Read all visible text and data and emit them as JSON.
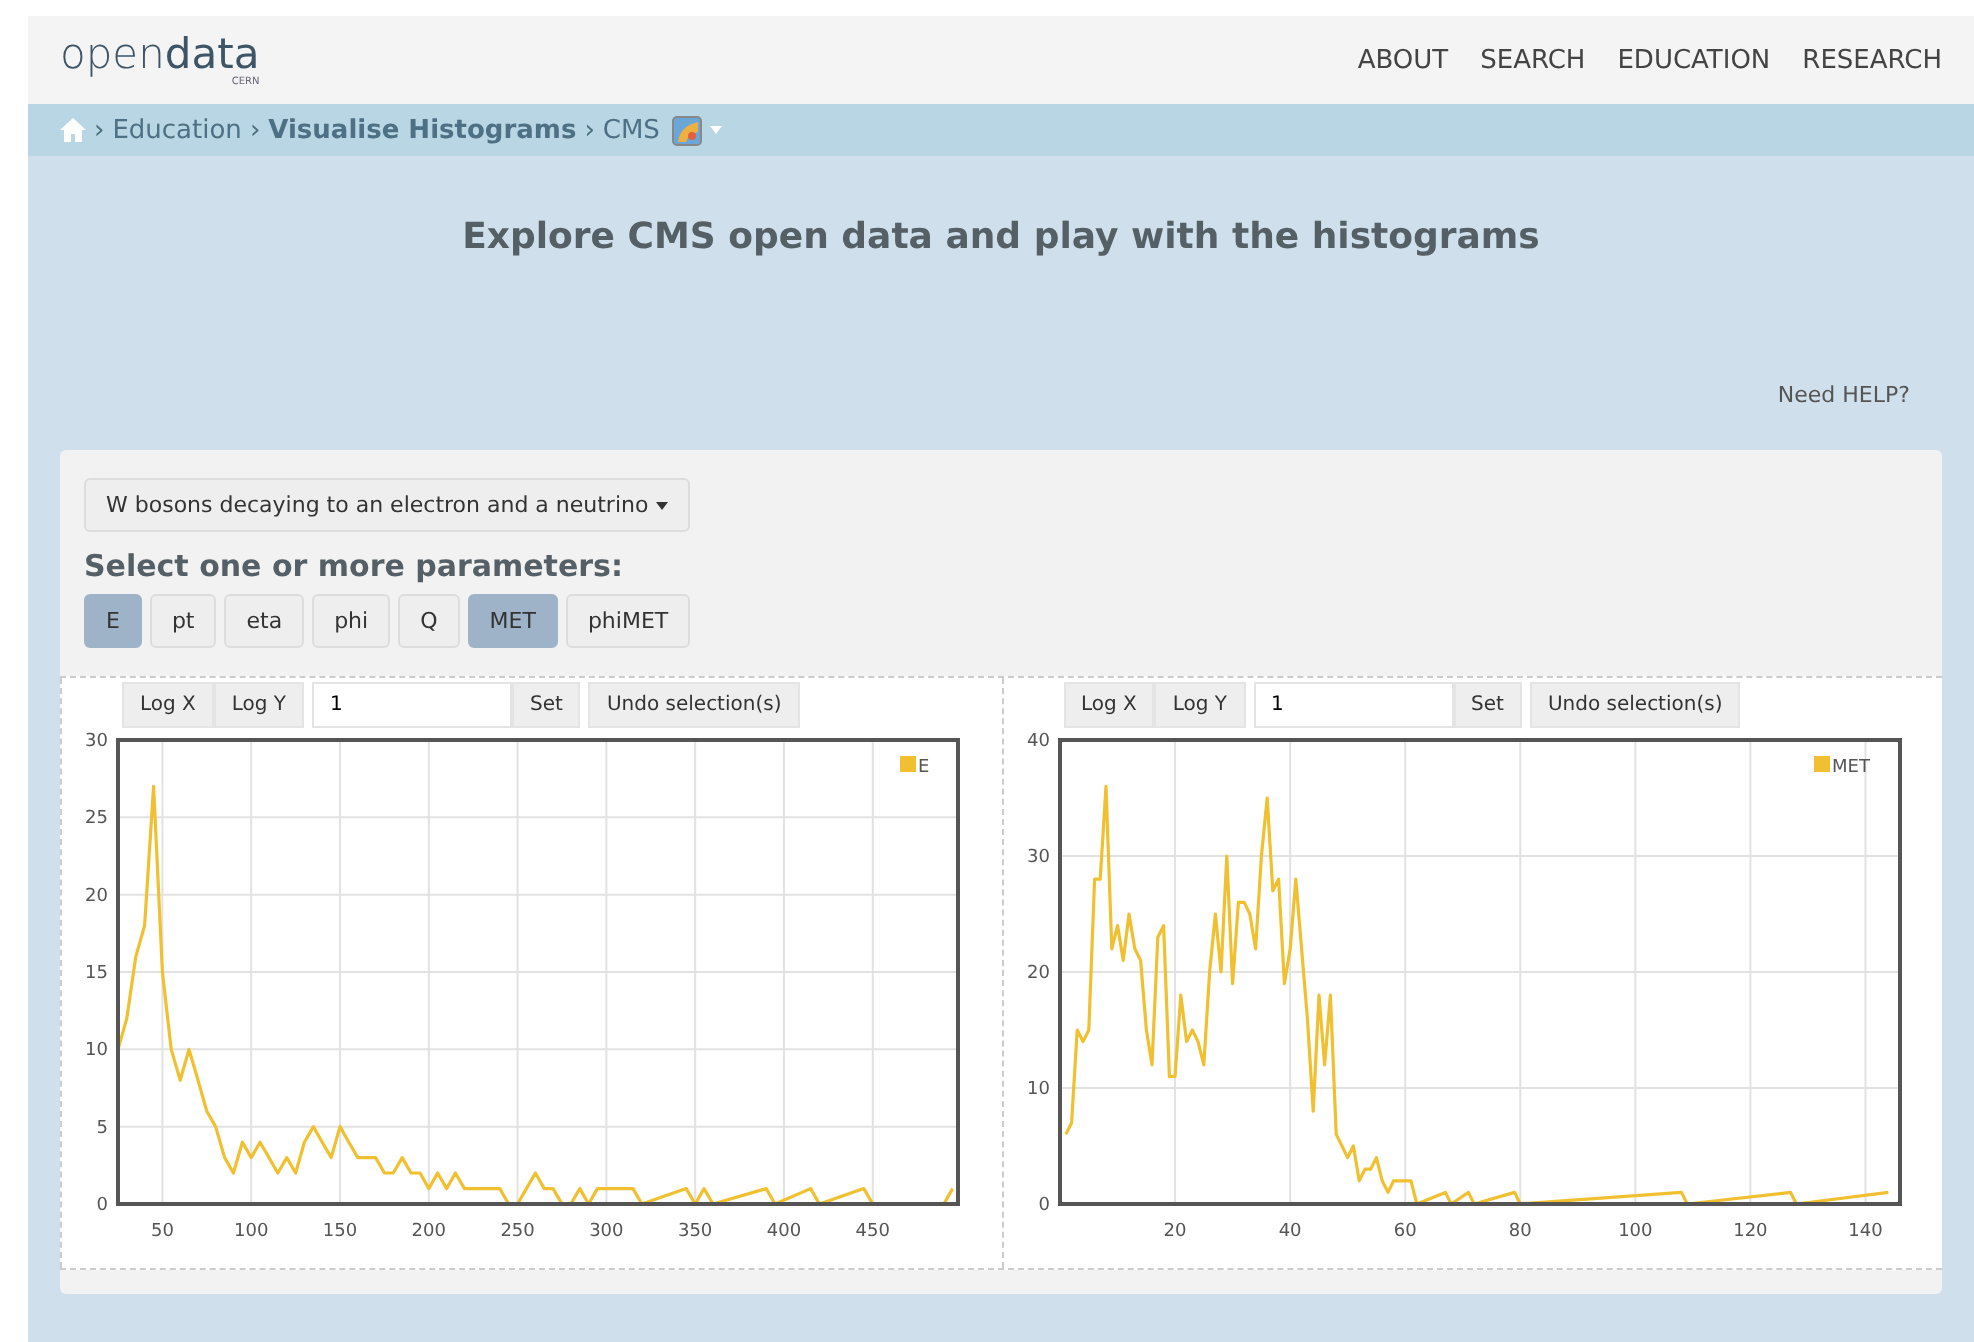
{
  "header": {
    "logo": "open**data**",
    "logo_sub": "CERN",
    "nav": [
      "ABOUT",
      "SEARCH",
      "EDUCATION",
      "RESEARCH"
    ]
  },
  "breadcrumb": {
    "separator": "›",
    "items": [
      {
        "label": "Education",
        "bold": false
      },
      {
        "label": "Visualise Histograms",
        "bold": true
      },
      {
        "label": "CMS",
        "bold": false
      }
    ]
  },
  "title": "Explore CMS open data and play with the histograms",
  "help_link": "Need HELP?",
  "dataset_dropdown": "W bosons decaying to an electron and a neutrino",
  "params_heading": "Select one or more parameters:",
  "params": [
    {
      "label": "E",
      "selected": true
    },
    {
      "label": "pt",
      "selected": false
    },
    {
      "label": "eta",
      "selected": false
    },
    {
      "label": "phi",
      "selected": false
    },
    {
      "label": "Q",
      "selected": false
    },
    {
      "label": "MET",
      "selected": true
    },
    {
      "label": "phiMET",
      "selected": false
    }
  ],
  "histograms": [
    {
      "toolbar": {
        "log_x": "Log X",
        "log_y": "Log Y",
        "bins_value": "1",
        "set": "Set",
        "undo": "Undo selection(s)"
      },
      "chart_data": {
        "type": "line",
        "grid": true,
        "xlim": [
          25,
          498
        ],
        "ylim": [
          0,
          30
        ],
        "xticks": [
          50,
          100,
          150,
          200,
          250,
          300,
          350,
          400,
          450
        ],
        "yticks": [
          0,
          5,
          10,
          15,
          20,
          25,
          30
        ],
        "x": [
          25,
          30,
          35,
          40,
          45,
          50,
          55,
          60,
          65,
          70,
          75,
          80,
          85,
          90,
          95,
          100,
          105,
          110,
          115,
          120,
          125,
          130,
          135,
          140,
          145,
          150,
          155,
          160,
          165,
          170,
          175,
          180,
          185,
          190,
          195,
          200,
          205,
          210,
          215,
          220,
          225,
          230,
          235,
          240,
          245,
          250,
          255,
          260,
          265,
          270,
          275,
          280,
          285,
          290,
          295,
          300,
          305,
          310,
          315,
          320,
          345,
          350,
          355,
          360,
          390,
          395,
          415,
          420,
          445,
          450,
          490,
          495
        ],
        "series": [
          {
            "name": "E",
            "color": "#f0c030",
            "values": [
              10,
              12,
              16,
              18,
              27,
              15,
              10,
              8,
              10,
              8,
              6,
              5,
              3,
              2,
              4,
              3,
              4,
              3,
              2,
              3,
              2,
              4,
              5,
              4,
              3,
              5,
              4,
              3,
              3,
              3,
              2,
              2,
              3,
              2,
              2,
              1,
              2,
              1,
              2,
              1,
              1,
              1,
              1,
              1,
              0,
              0,
              1,
              2,
              1,
              1,
              0,
              0,
              1,
              0,
              1,
              1,
              1,
              1,
              1,
              0,
              1,
              0,
              1,
              0,
              1,
              0,
              1,
              0,
              1,
              0,
              0,
              1
            ]
          }
        ]
      }
    },
    {
      "toolbar": {
        "log_x": "Log X",
        "log_y": "Log Y",
        "bins_value": "1",
        "set": "Set",
        "undo": "Undo selection(s)"
      },
      "chart_data": {
        "type": "line",
        "grid": true,
        "xlim": [
          0,
          146
        ],
        "ylim": [
          0,
          40
        ],
        "xticks": [
          20,
          40,
          60,
          80,
          100,
          120,
          140
        ],
        "yticks": [
          0,
          10,
          20,
          30,
          40
        ],
        "x": [
          1,
          2,
          3,
          4,
          5,
          6,
          7,
          8,
          9,
          10,
          11,
          12,
          13,
          14,
          15,
          16,
          17,
          18,
          19,
          20,
          21,
          22,
          23,
          24,
          25,
          26,
          27,
          28,
          29,
          30,
          31,
          32,
          33,
          34,
          35,
          36,
          37,
          38,
          39,
          40,
          41,
          42,
          43,
          44,
          45,
          46,
          47,
          48,
          49,
          50,
          51,
          52,
          53,
          54,
          55,
          56,
          57,
          58,
          59,
          60,
          61,
          62,
          67,
          68,
          71,
          72,
          79,
          80,
          108,
          109,
          127,
          128,
          144
        ],
        "series": [
          {
            "name": "MET",
            "color": "#f0c030",
            "values": [
              6,
              7,
              15,
              14,
              15,
              28,
              28,
              36,
              22,
              24,
              21,
              25,
              22,
              21,
              15,
              12,
              23,
              24,
              11,
              11,
              18,
              14,
              15,
              14,
              12,
              20,
              25,
              20,
              30,
              19,
              26,
              26,
              25,
              22,
              30,
              35,
              27,
              28,
              19,
              22,
              28,
              22,
              16,
              8,
              18,
              12,
              18,
              6,
              5,
              4,
              5,
              2,
              3,
              3,
              4,
              2,
              1,
              2,
              2,
              2,
              2,
              0,
              1,
              0,
              1,
              0,
              1,
              0,
              1,
              0,
              1,
              0,
              1
            ]
          }
        ]
      }
    }
  ]
}
